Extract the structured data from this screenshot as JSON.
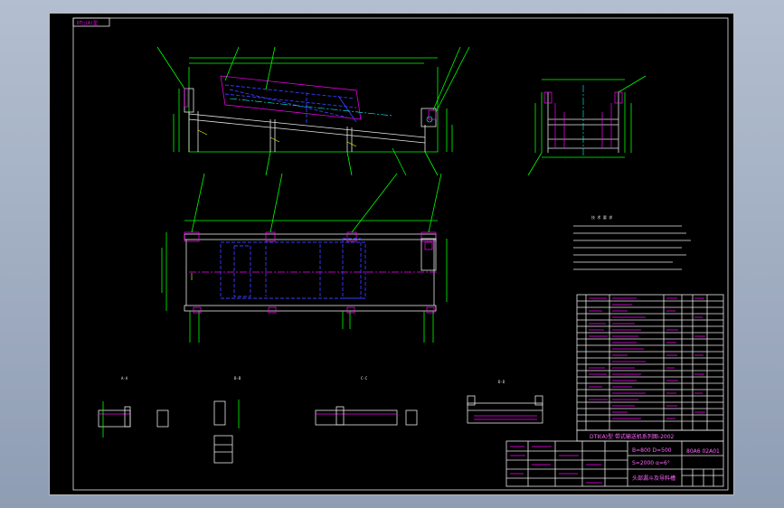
{
  "title_block": {
    "drawing_title": "DTⅡ(A)型 带式输送机系列图-2002",
    "spec_1": "B=800 D=500",
    "spec_2": "S=2000 α=6°",
    "drawing_no": "80A6 02A01",
    "part_name": "头部漏斗及导料槽"
  },
  "labels": {
    "top_tag": "DT□(A)型",
    "tech_title": "技 术 要 求",
    "section_1": "A-A",
    "section_2": "B-B",
    "section_3": "C-C",
    "section_4": "D-D"
  },
  "colors": {
    "green": "#00ff00",
    "white": "#e8e8e8",
    "blue": "#3b3bff",
    "magenta": "#ff00ff",
    "canvas": "#000000",
    "background": "#a6b3c6"
  }
}
